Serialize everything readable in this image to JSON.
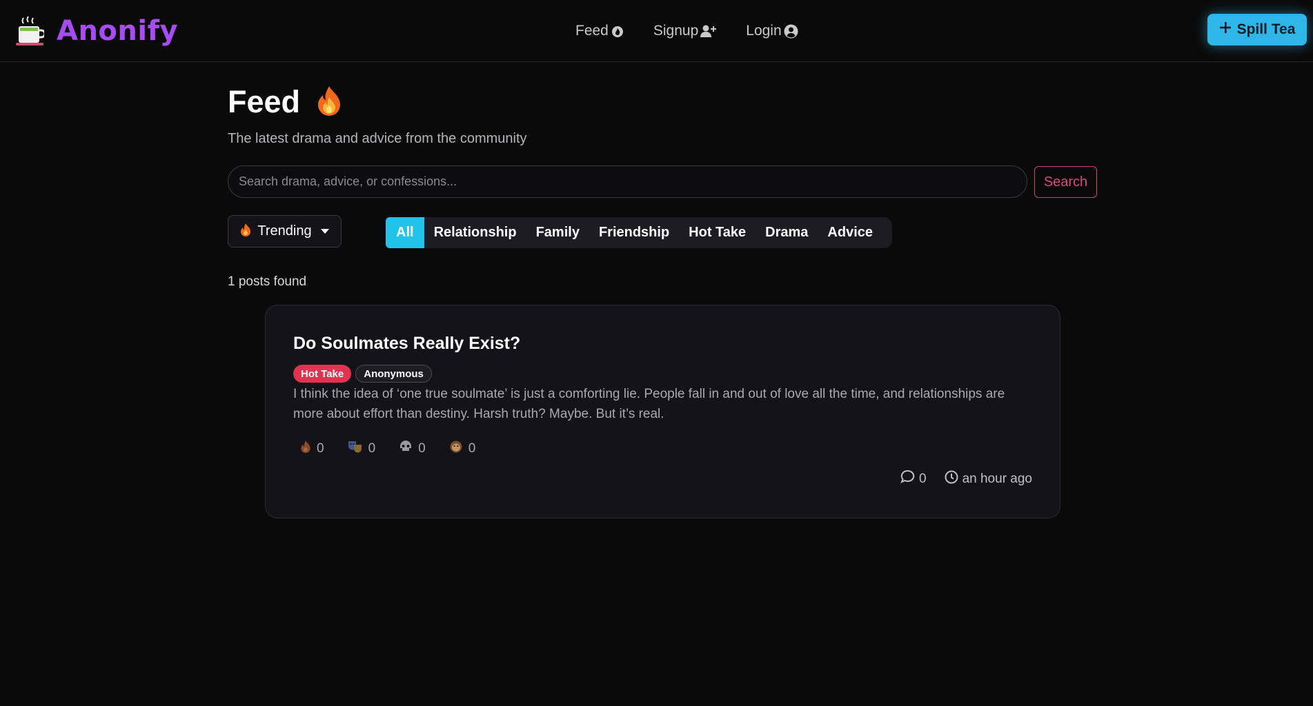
{
  "nav": {
    "brand": "Anonify",
    "links": [
      {
        "label": "Feed",
        "icon": "fire-icon"
      },
      {
        "label": "Signup",
        "icon": "user-plus-icon"
      },
      {
        "label": "Login",
        "icon": "user-circle-icon"
      }
    ],
    "cta_label": "Spill Tea",
    "cta_icon": "plus-icon"
  },
  "header": {
    "title": "Feed",
    "title_icon": "fire-icon",
    "subtitle": "The latest drama and advice from the community"
  },
  "search": {
    "placeholder": "Search drama, advice, or confessions...",
    "value": "",
    "button_label": "Search"
  },
  "sort": {
    "selected": "Trending",
    "icon": "fire-icon"
  },
  "categories": {
    "tabs": [
      "All",
      "Relationship",
      "Family",
      "Friendship",
      "Hot Take",
      "Drama",
      "Advice"
    ],
    "active": "All"
  },
  "results": {
    "count_text": "1 posts found"
  },
  "posts": [
    {
      "title": "Do Soulmates Really Exist?",
      "category": "Hot Take",
      "author": "Anonymous",
      "body": "I think the idea of ‘one true soulmate’ is just a comforting lie. People fall in and out of love all the time, and relationships are more about effort than destiny. Harsh truth? Maybe. But it’s real.",
      "reactions": [
        {
          "icon": "fire-icon",
          "count": "0"
        },
        {
          "icon": "theater-masks-icon",
          "count": "0"
        },
        {
          "icon": "skull-icon",
          "count": "0"
        },
        {
          "icon": "monkey-face-icon",
          "count": "0"
        }
      ],
      "comments": "0",
      "time": "an hour ago"
    }
  ],
  "colors": {
    "background": "#0b0a0a",
    "brand": "#a64cf0",
    "cta": "#2fb6e8",
    "active_tab": "#21c4e8",
    "search_button": "#e0457f",
    "hot_take_badge": "#e0334f",
    "card": "#141319"
  }
}
